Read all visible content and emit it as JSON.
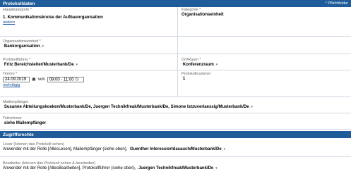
{
  "header": {
    "title": "Protokolldaten",
    "required_note": "* Pflichtfelder"
  },
  "hauptkategorie": {
    "label": "Hauptkategorie *",
    "value": "1. Kommunikationskreise der Aufbauorganisation",
    "change_link": "ändern"
  },
  "kategorie": {
    "label": "Kategorie *",
    "value": "Organisationseinheit"
  },
  "organisationseinheit": {
    "label": "Organisationseinheit *",
    "value": "Bankorganisation"
  },
  "protokollfuehrer": {
    "label": "Protokollführer *",
    "value": "Fritz Bereichsleiter/Musterbank/De"
  },
  "ort": {
    "label": "Ort/Raum *",
    "value": "Konferenzraum"
  },
  "termin": {
    "label": "Termin *",
    "date": "24.09.2019",
    "von_label": "von",
    "time": "09:00 - 11:00",
    "recurring_link": "mehrtägig"
  },
  "protokollnummer": {
    "label": "Protokollnummer",
    "value": "1"
  },
  "mailempfaenger": {
    "label": "Mailempfänger",
    "value": "Susanne Abteilungskoeken/Musterbank/De, Juergen Technikfreak/Musterbank/De, Simone Istzuverlaessig/Musterbank/De"
  },
  "teilnehmer": {
    "label": "Teilnehmer",
    "value": "siehe Mailempfänger"
  },
  "zugriff": {
    "title": "Zugriffsrechte"
  },
  "leser": {
    "label": "Leser (können das Protokoll sehen)",
    "text": "Anwender mit der Rolle [AllesLesen], Mailempfänger (siehe oben),",
    "value": "Guenther Interessiertdasauch/Musterbank/De"
  },
  "bearbeiter": {
    "label": "Bearbeiter (können das Protokoll sehen & bearbeiten)",
    "text": "Anwender mit der Rolle [AllesBearbeiten], Protokollführer (siehe oben),",
    "value": "Juergen Technikfreak/Musterbank/De"
  }
}
